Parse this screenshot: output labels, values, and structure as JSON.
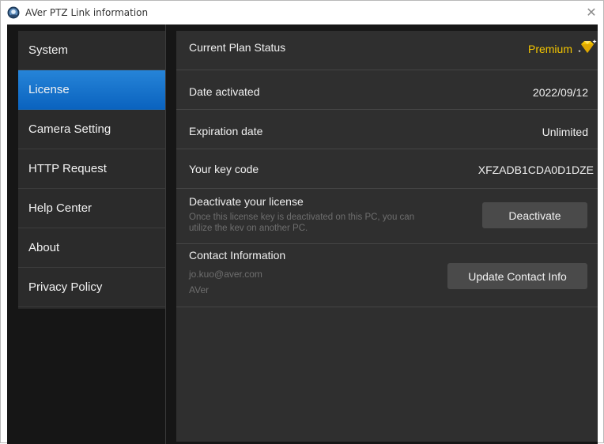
{
  "window": {
    "title": "AVer PTZ Link information",
    "close_glyph": "✕"
  },
  "sidebar": {
    "items": [
      {
        "label": "System",
        "active": false
      },
      {
        "label": "License",
        "active": true
      },
      {
        "label": "Camera Setting",
        "active": false
      },
      {
        "label": "HTTP Request",
        "active": false
      },
      {
        "label": "Help Center",
        "active": false
      },
      {
        "label": "About",
        "active": false
      },
      {
        "label": "Privacy Policy",
        "active": false
      }
    ]
  },
  "license": {
    "plan_label": "Current Plan Status",
    "plan_value": "Premium",
    "plan_icon": "diamond-icon",
    "date_label": "Date activated",
    "date_value": "2022/09/12",
    "expiry_label": "Expiration date",
    "expiry_value": "Unlimited",
    "key_label": "Your key code",
    "key_value": "XFZADB1CDA0D1DZE",
    "deactivate_title": "Deactivate your license",
    "deactivate_desc_line1": "Once this license key is deactivated on this PC, you can",
    "deactivate_desc_line2": "utilize the kev on another PC.",
    "deactivate_button": "Deactivate",
    "contact_title": "Contact Information",
    "contact_email": "jo.kuo@aver.com",
    "contact_company": "AVer",
    "update_contact_button": "Update Contact Info"
  },
  "colors": {
    "accent_blue": "#0a63bf",
    "premium_gold": "#f3c500",
    "panel_bg": "#2f2f2f",
    "window_bg": "#161616"
  }
}
